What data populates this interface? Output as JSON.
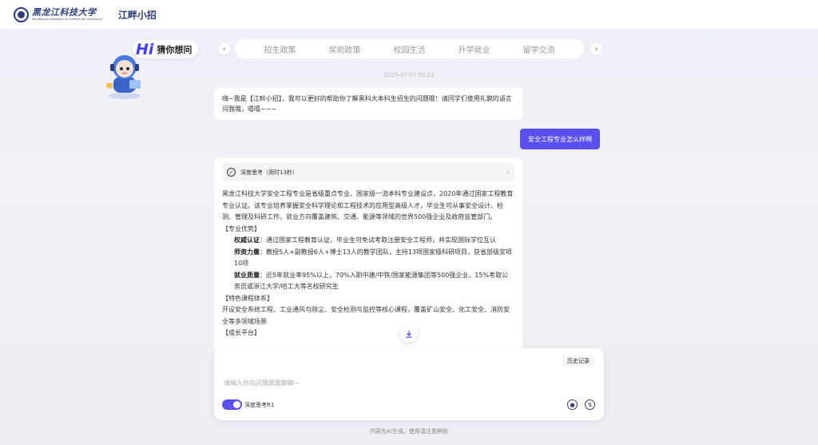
{
  "header": {
    "logo_cn": "黑龙江科技大学",
    "logo_en": "HEILONGJIANG UNIVERSITY OF SCIENCE AND TECHNOLOGY",
    "brand": "江畔小招"
  },
  "hi_badge": {
    "hi": "Hi",
    "label": "猜你想问"
  },
  "nav": {
    "prev": "‹",
    "next": "›",
    "tabs": [
      {
        "label": "招生政策"
      },
      {
        "label": "奖助政策"
      },
      {
        "label": "校园生活"
      },
      {
        "label": "升学就业"
      },
      {
        "label": "留学交流"
      }
    ]
  },
  "chat": {
    "timestamp": "2025-07-07 03:21",
    "greeting": "嗨~我是【江畔小招】，我可以更好的帮助你了解黑科大本科生招生的问题哦！请同学们使用礼貌的语言问我哦，嘻嘻~~~",
    "user_question": "安全工程专业怎么样啊",
    "thinking_label": "深度思考（用时13秒）",
    "answer": {
      "intro": "黑龙江科技大学安全工程专业是省级重点专业、国家级一流本科专业建设点，2020年通过国家工程教育专业认证。该专业培养掌握安全科学理论和工程技术的应用型高级人才，毕业生可从事安全设计、检测、管理及科研工作，就业方向覆盖建筑、交通、能源等领域的世界500强企业及政府监管部门。",
      "section1": "【专业优势】",
      "item1_title": "权威认证",
      "item1_text": "：通过国家工程教育认证，毕业生可免试考取注册安全工程师，并实现国际学位互认",
      "item2_title": "师资力量",
      "item2_text": "：教授5人+副教授6人+博士13人的教学团队，主持13项国家级科研项目，获省部级奖项10项",
      "item3_title": "就业质量",
      "item3_text": "：近5年就业率95%以上，70%入职中建/中铁/国家能源集团等500强企业，15%考取公务员或浙江大学/哈工大等名校研究生",
      "section2": "【特色课程体系】",
      "courses": "开设安全系统工程、工业通风与除尘、安全检测与监控等核心课程，覆盖矿山安全、化工安全、消防安全等多领域场景",
      "section3": "【成长平台】"
    }
  },
  "input": {
    "history": "历史记录",
    "placeholder": "请输入你的问题跟我聊聊~",
    "toggle_label": "深度思考R1"
  },
  "footer": "内容为AI生成，使用请注意辨别",
  "colors": {
    "accent": "#5b4ff0",
    "brand": "#2c3c7c"
  }
}
